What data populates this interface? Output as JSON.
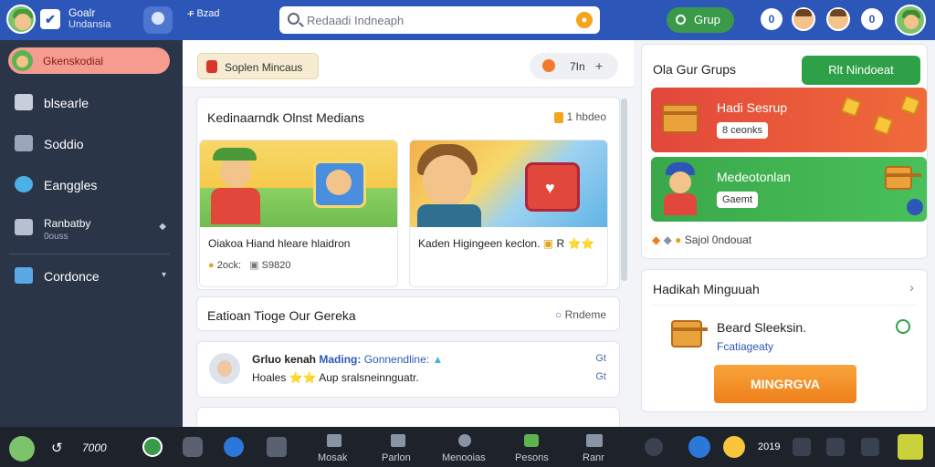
{
  "topbar": {
    "app_title_line1": "Goalr",
    "app_title_line2": "Undansia",
    "lang": "ꜰ̶ Bzad",
    "search_placeholder": "Redaadi Indneaph",
    "grup_label": "Grup",
    "round_btn_1": "0",
    "round_btn_2": "0"
  },
  "sidebar": {
    "active_label": "Gkenskodial",
    "items": [
      {
        "label": "blsearle"
      },
      {
        "label": "Soddio"
      },
      {
        "label": "Eanggles"
      },
      {
        "label": "Ranbatby",
        "sub": "0ouss"
      },
      {
        "label": "Cordonce"
      }
    ]
  },
  "main": {
    "chip_label": "Soplen Mincaus",
    "count_value": "7In",
    "count_plus": "+",
    "section1": {
      "title": "Kedinaarndk Olnst Medians",
      "badge": "1 hbdeo"
    },
    "posts": [
      {
        "title": "Oiakoa Hiand hleare hlaidron",
        "meta_left": "2ock:",
        "meta_right": "S9820"
      },
      {
        "title": "Kaden Higingeen keclon.",
        "meta_right": "R ⭐⭐"
      }
    ],
    "section2": {
      "title": "Eatioan Tioge Our Gereka",
      "badge": "Rndeme"
    },
    "comment": {
      "name": "Grluo kenah",
      "highlight": "Mading:",
      "rest": "Gonnendline:",
      "line2": "Hoales ⭐⭐ Aup sralsneinnguatr.",
      "follow_top": "Gt",
      "follow_bottom": "Gt"
    }
  },
  "right": {
    "groups_title": "Ola Gur Grups",
    "join_button": "Rlt Nindoeat",
    "promo_red": {
      "title": "Hadi Sesrup",
      "tag": "8 ceonks"
    },
    "promo_green": {
      "title": "Medeotonlan",
      "tag": "Gaemt"
    },
    "stats_line": "Sajol 0ndouat",
    "reward_title": "Hadikah Minguuah",
    "reward_name": "Beard Sleeksin.",
    "reward_sub": "Fcatiageaty",
    "reward_button": "MINGRGVA"
  },
  "taskbar": {
    "time": "7000",
    "date": "2019",
    "items": [
      {
        "label": "Mosak"
      },
      {
        "label": "Parlon"
      },
      {
        "label": "Menooias"
      },
      {
        "label": "Pesons"
      },
      {
        "label": "Ranr"
      }
    ]
  },
  "colors": {
    "topbar": "#2c57b8",
    "sidebar": "#2a3548",
    "accent_green": "#2ea047",
    "accent_orange": "#ef7f1a",
    "promo_red": "#e2473b"
  }
}
